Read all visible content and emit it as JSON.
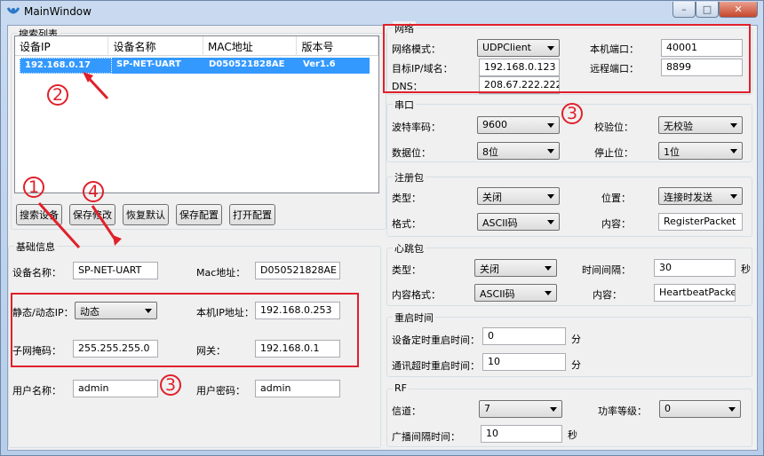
{
  "window": {
    "title": "MainWindow",
    "minimize": "–",
    "maximize": "□",
    "close": "✕"
  },
  "search": {
    "group_title": "搜索列表",
    "columns": [
      "设备IP",
      "设备名称",
      "MAC地址",
      "版本号"
    ],
    "rows": [
      {
        "ip": "192.168.0.17",
        "name": "SP-NET-UART",
        "mac": "D050521828AE",
        "version": "Ver1.6"
      }
    ],
    "buttons": {
      "search": "搜索设备",
      "save_modify": "保存修改",
      "restore": "恢复默认",
      "save_config": "保存配置",
      "open_config": "打开配置"
    }
  },
  "basic": {
    "group_title": "基础信息",
    "device_name_label": "设备名称：",
    "device_name": "SP-NET-UART",
    "mac_label": "Mac地址：",
    "mac": "D050521828AE",
    "ip_mode_label": "静态/动态IP：",
    "ip_mode": "动态",
    "local_ip_label": "本机IP地址：",
    "local_ip": "192.168.0.253",
    "subnet_label": "子网掩码：",
    "subnet": "255.255.255.0",
    "gateway_label": "网关：",
    "gateway": "192.168.0.1",
    "user_label": "用户名称：",
    "user": "admin",
    "pwd_label": "用户密码：",
    "pwd": "admin"
  },
  "network": {
    "group_title": "网络",
    "mode_label": "网络模式：",
    "mode": "UDPClient",
    "local_port_label": "本机端口：",
    "local_port": "40001",
    "target_label": "目标IP/域名：",
    "target": "192.168.0.123",
    "remote_port_label": "远程端口：",
    "remote_port": "8899",
    "dns_label": "DNS：",
    "dns": "208.67.222.222"
  },
  "serial": {
    "group_title": "串口",
    "baud_label": "波特率码：",
    "baud": "9600",
    "parity_label": "校验位：",
    "parity": "无校验",
    "databits_label": "数据位：",
    "databits": "8位",
    "stopbits_label": "停止位：",
    "stopbits": "1位"
  },
  "register": {
    "group_title": "注册包",
    "type_label": "类型：",
    "type": "关闭",
    "position_label": "位置：",
    "position": "连接时发送",
    "format_label": "格式：",
    "format": "ASCII码",
    "content_label": "内容：",
    "content": "RegisterPacket"
  },
  "heartbeat": {
    "group_title": "心跳包",
    "type_label": "类型：",
    "type": "关闭",
    "interval_label": "时间间隔：",
    "interval": "30",
    "interval_unit": "秒",
    "format_label": "内容格式：",
    "format": "ASCII码",
    "content_label": "内容：",
    "content": "HeartbeatPacke"
  },
  "restart": {
    "group_title": "重启时间",
    "timed_label": "设备定时重启时间：",
    "timed": "0",
    "timed_unit": "分",
    "timeout_label": "通讯超时重启时间：",
    "timeout": "10",
    "timeout_unit": "分"
  },
  "rf": {
    "group_title": "RF",
    "channel_label": "信道：",
    "channel": "7",
    "power_label": "功率等级：",
    "power": "0",
    "interval_label": "广播间隔时间：",
    "interval": "10",
    "interval_unit": "秒"
  },
  "annotations": {
    "n1": "1",
    "n2": "2",
    "n3": "3",
    "n4": "4"
  },
  "colors": {
    "accent_red": "#e0202a",
    "selection": "#3399ff"
  }
}
